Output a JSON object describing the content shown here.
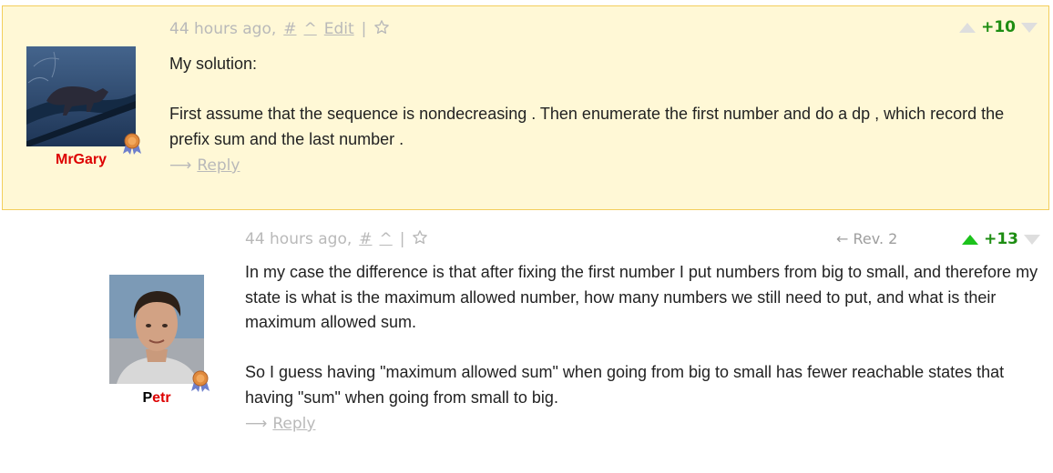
{
  "comments": [
    {
      "author": "MrGary",
      "author_first_letter": "",
      "author_rest": "MrGary",
      "author_color": "#dd0000",
      "time": "44 hours ago,",
      "anchor": "#",
      "parent": "^",
      "edit": "Edit",
      "separator": "|",
      "score": "+10",
      "upvoted": false,
      "paragraphs": [
        "My solution:",
        "First assume that the sequence is nondecreasing . Then enumerate the first number and do a dp , which record the prefix sum and the last number ."
      ],
      "reply_arrow": "⟶",
      "reply": "Reply",
      "highlighted": true,
      "avatar": "fox-photo"
    },
    {
      "author": "Petr",
      "author_first_letter": "P",
      "author_rest": "etr",
      "author_color": "#dd0000",
      "time": "44 hours ago,",
      "anchor": "#",
      "parent": "^",
      "separator": "|",
      "revision": "← Rev. 2",
      "score": "+13",
      "upvoted": true,
      "paragraphs": [
        "In my case the difference is that after fixing the first number I put numbers from big to small, and therefore my state is what is the maximum allowed number, how many numbers we still need to put, and what is their maximum allowed sum.",
        "So I guess having \"maximum allowed sum\" when going from big to small has fewer reachable states that having \"sum\" when going from small to big."
      ],
      "reply_arrow": "⟶",
      "reply": "Reply",
      "highlighted": false,
      "avatar": "person-photo"
    }
  ],
  "icons": {
    "star": "star-outline-icon",
    "medal": "medal-icon",
    "vote_up": "vote-up-icon",
    "vote_down": "vote-down-icon"
  },
  "colors": {
    "highlight_bg": "#fff8d6",
    "highlight_border": "#f3ce5c",
    "score_green": "#1d8d12",
    "upvote_green": "#1cc21c",
    "meta_gray": "#b9b9b9",
    "username_red": "#dd0000"
  }
}
